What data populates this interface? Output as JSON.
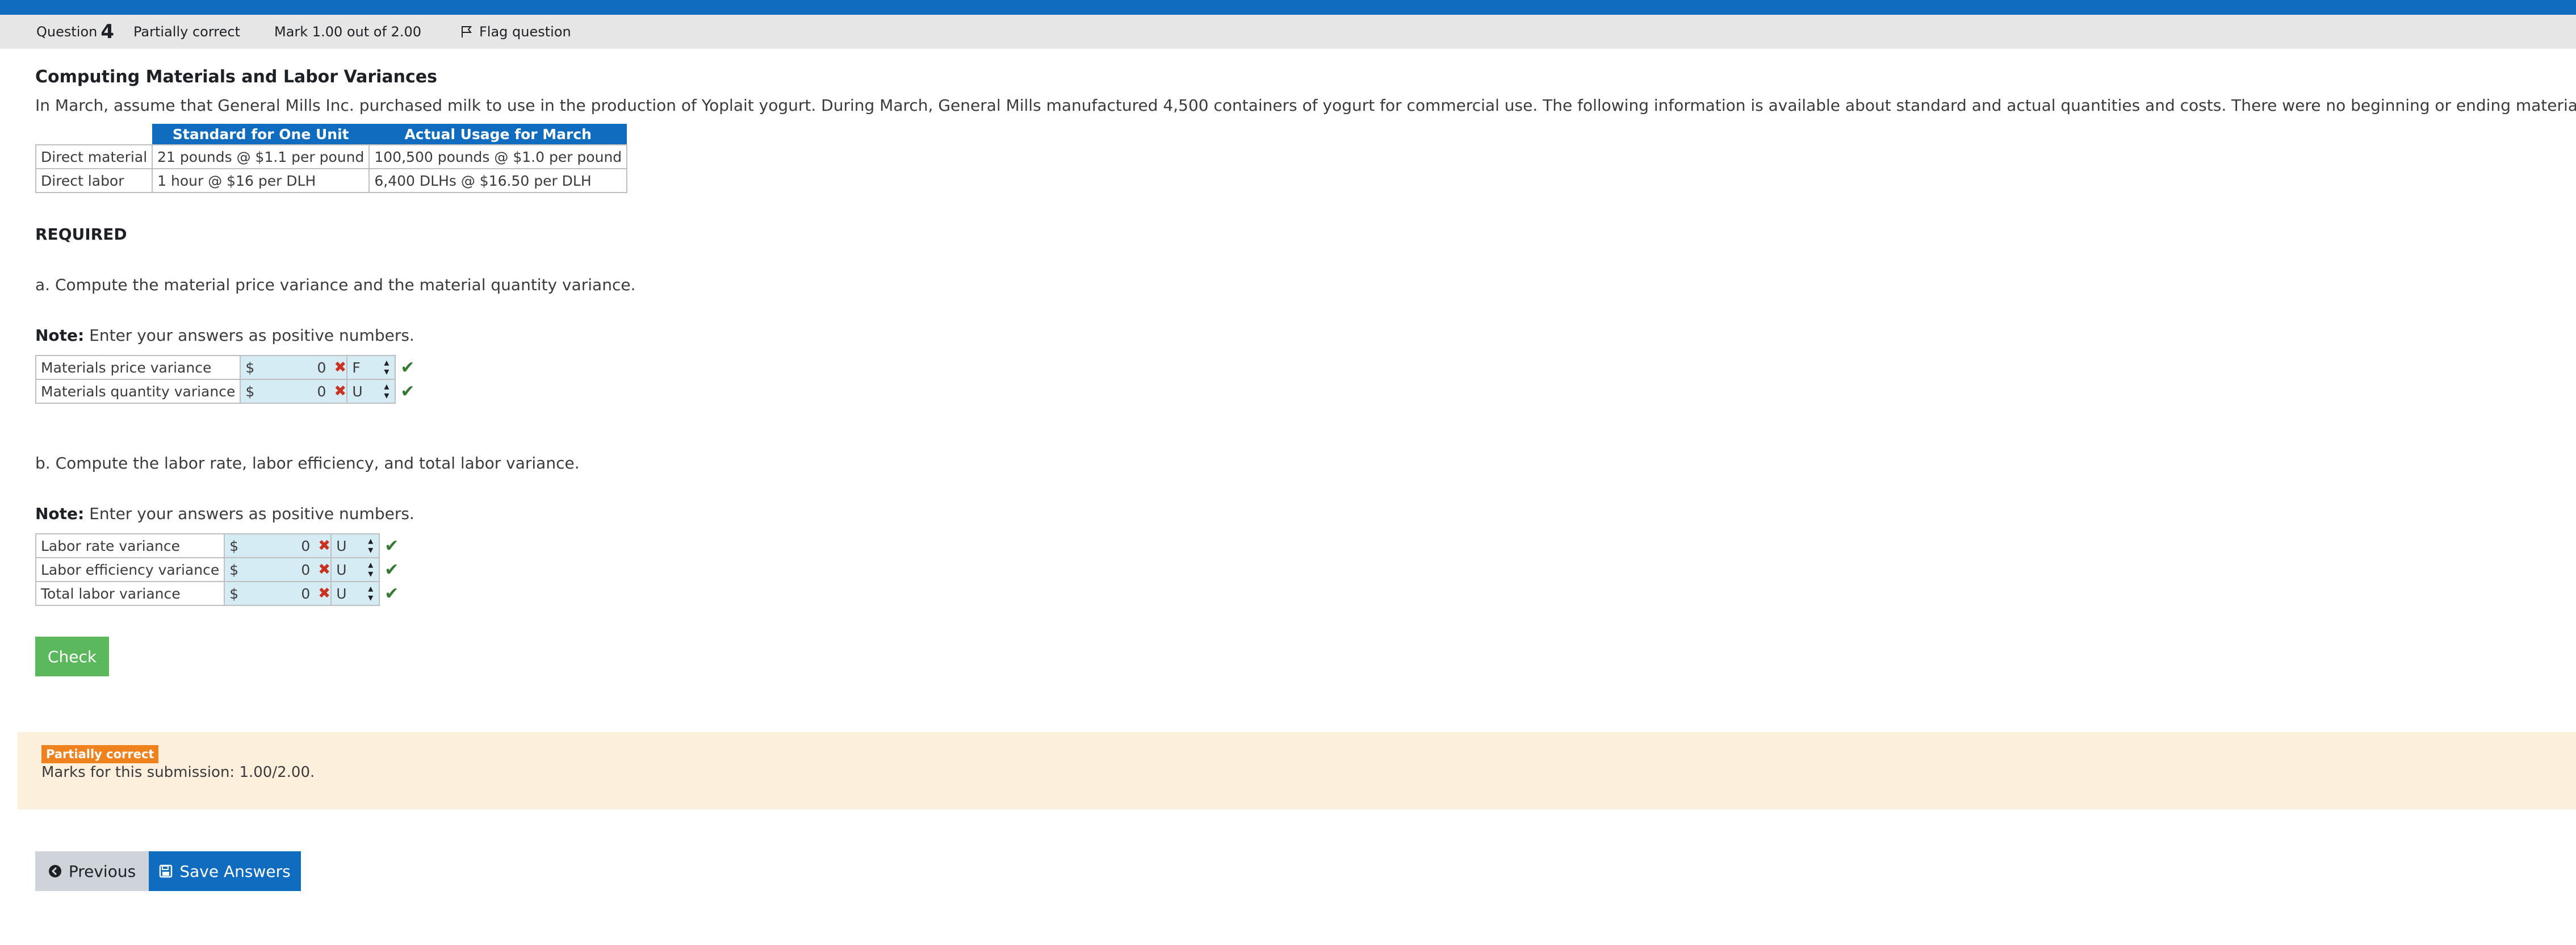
{
  "header": {
    "question_label": "Question",
    "question_number": "4",
    "state": "Partially correct",
    "mark": "Mark 1.00 out of 2.00",
    "flag_label": "Flag question"
  },
  "title": "Computing Materials and Labor Variances",
  "intro": "In March, assume that General Mills Inc. purchased milk to use in the production of Yoplait yogurt. During March, General Mills manufactured 4,500 containers of yogurt for commercial use. The following information is available about standard and actual quantities and costs. There were no beginning or ending materials inventories.",
  "info_table": {
    "headers": [
      "",
      "Standard for One Unit",
      "Actual Usage for March"
    ],
    "rows": [
      [
        "Direct material",
        "21 pounds @ $1.1 per pound",
        "100,500 pounds @ $1.0 per pound"
      ],
      [
        "Direct labor",
        "1 hour @ $16 per DLH",
        "6,400 DLHs @ $16.50 per DLH"
      ]
    ]
  },
  "required": "REQUIRED",
  "part_a": {
    "prompt": "a. Compute the material price variance and the material quantity variance.",
    "note_label": "Note:",
    "note_text": " Enter your answers as positive numbers.",
    "rows": [
      {
        "label": "Materials price variance",
        "currency": "$",
        "value": "0",
        "select": "F"
      },
      {
        "label": "Materials quantity variance",
        "currency": "$",
        "value": "0",
        "select": "U"
      }
    ]
  },
  "part_b": {
    "prompt": "b. Compute the labor rate, labor efficiency, and total labor variance.",
    "note_label": "Note:",
    "note_text": " Enter your answers as positive numbers.",
    "rows": [
      {
        "label": "Labor rate variance",
        "currency": "$",
        "value": "0",
        "select": "U"
      },
      {
        "label": "Labor efficiency variance",
        "currency": "$",
        "value": "0",
        "select": "U"
      },
      {
        "label": "Total labor variance",
        "currency": "$",
        "value": "0",
        "select": "U"
      }
    ]
  },
  "check_label": "Check",
  "feedback": {
    "badge": "Partially correct",
    "marks": "Marks for this submission: 1.00/2.00."
  },
  "nav": {
    "previous_label": "Previous",
    "save_label": "Save Answers"
  },
  "colors": {
    "brand_blue": "#0f6cbf",
    "check_green": "#5cb85c",
    "wrong_red": "#ca3120",
    "correct_green": "#357a32",
    "feedback_bg": "#fcefdc",
    "badge_orange": "#f0821e"
  }
}
